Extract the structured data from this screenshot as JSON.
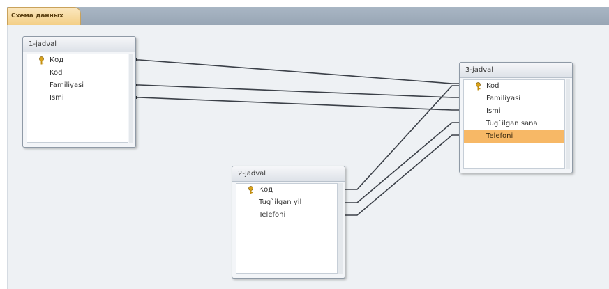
{
  "tab": {
    "label": "Схема данных"
  },
  "tables": {
    "t1": {
      "title": "1-jadval",
      "fields": [
        "Код",
        "Kod",
        "Familiyasi",
        "Ismi"
      ]
    },
    "t2": {
      "title": "2-jadval",
      "fields": [
        "Код",
        "Tug`ilgan yil",
        "Telefoni"
      ]
    },
    "t3": {
      "title": "3-jadval",
      "fields": [
        "Kod",
        "Familiyasi",
        "Ismi",
        "Tug`ilgan sana",
        "Telefoni"
      ]
    }
  },
  "selected_field": "3-jadval.Telefoni",
  "colors": {
    "selection": "#f7b866",
    "tab": "#f3cf86",
    "ribbon": "#a9b6c4"
  },
  "icons": {
    "primary_key": "key-icon"
  }
}
